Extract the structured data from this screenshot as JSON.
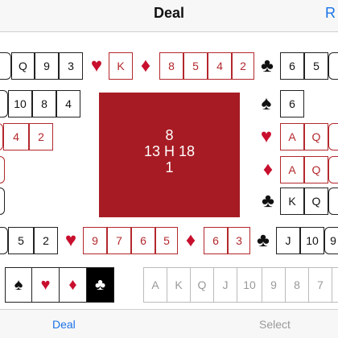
{
  "nav": {
    "title": "Deal",
    "right_button": "R"
  },
  "west_hand": {
    "spades": [
      "Q",
      "9",
      "3"
    ],
    "hearts": [
      "10",
      "8",
      "4"
    ],
    "diamonds": [
      "4",
      "2"
    ],
    "clubs": [
      "5",
      "2"
    ]
  },
  "north_hand": {
    "hearts": [
      "K"
    ],
    "diamonds": [
      "8",
      "5",
      "4",
      "2"
    ],
    "clubs": [
      "6",
      "5"
    ]
  },
  "east_hand": {
    "spades": [
      "6"
    ],
    "hearts": [
      "A",
      "Q"
    ],
    "diamonds": [
      "A",
      "Q"
    ],
    "clubs": [
      "K",
      "Q"
    ]
  },
  "south_hand": {
    "hearts": [
      "9",
      "7",
      "6",
      "5"
    ],
    "diamonds": [
      "6",
      "3"
    ],
    "clubs": [
      "J",
      "10",
      "9"
    ]
  },
  "table": {
    "top": "8",
    "west": "13",
    "dealer": "H",
    "east": "18",
    "bottom": "1"
  },
  "suit_selector": [
    "♠",
    "♥",
    "♦",
    "♣"
  ],
  "rank_selector": [
    "A",
    "K",
    "Q",
    "J",
    "10",
    "9",
    "8",
    "7"
  ],
  "suits": {
    "spade": "♠",
    "heart": "♥",
    "diamond": "♦",
    "club": "♣"
  },
  "colors": {
    "red": "#c8102e",
    "table": "#a71c24",
    "accent": "#1a73e8"
  },
  "tabs": {
    "deal": "Deal",
    "select": "Select"
  }
}
